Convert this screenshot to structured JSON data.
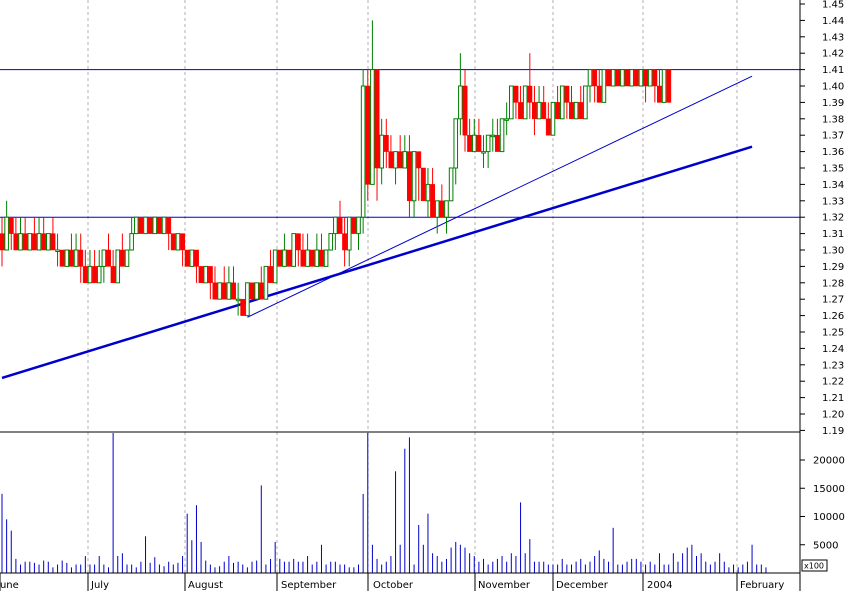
{
  "chart_data": [
    {
      "type": "candlestick",
      "title": "",
      "y_ticks": [
        "1.45",
        "1.44",
        "1.43",
        "1.42",
        "1.41",
        "1.40",
        "1.39",
        "1.38",
        "1.37",
        "1.36",
        "1.35",
        "1.34",
        "1.33",
        "1.32",
        "1.31",
        "1.30",
        "1.29",
        "1.28",
        "1.27",
        "1.26",
        "1.25",
        "1.24",
        "1.23",
        "1.22",
        "1.21",
        "1.20",
        "1.19"
      ],
      "ylim": [
        1.182,
        1.452
      ],
      "x_month_labels": [
        "June",
        "July",
        "August",
        "September",
        "October",
        "November",
        "December",
        "2004",
        "February"
      ],
      "up_color": "#008000",
      "down_color": "#ff0000",
      "horizontal_lines": [
        1.41,
        1.32
      ],
      "trendlines": [
        {
          "kind": "thick",
          "color": "#0000cc",
          "from": [
            0,
            1.222
          ],
          "to": [
            162,
            1.363
          ]
        },
        {
          "kind": "thin",
          "color": "#0000cc",
          "from": [
            53,
            1.259
          ],
          "to": [
            162,
            1.406
          ]
        }
      ],
      "ohlc_note": "daily bars, first bar ~ early June 2003, last bar ~ early February 2004",
      "candles": [
        [
          1.31,
          1.32,
          1.29,
          1.3
        ],
        [
          1.3,
          1.33,
          1.3,
          1.32
        ],
        [
          1.32,
          1.32,
          1.3,
          1.31
        ],
        [
          1.31,
          1.32,
          1.3,
          1.3
        ],
        [
          1.3,
          1.32,
          1.3,
          1.31
        ],
        [
          1.31,
          1.32,
          1.3,
          1.3
        ],
        [
          1.3,
          1.31,
          1.3,
          1.31
        ],
        [
          1.31,
          1.32,
          1.3,
          1.3
        ],
        [
          1.3,
          1.32,
          1.3,
          1.31
        ],
        [
          1.31,
          1.32,
          1.3,
          1.3
        ],
        [
          1.3,
          1.31,
          1.3,
          1.31
        ],
        [
          1.31,
          1.32,
          1.3,
          1.3
        ],
        [
          1.3,
          1.31,
          1.29,
          1.3
        ],
        [
          1.3,
          1.3,
          1.29,
          1.29
        ],
        [
          1.29,
          1.3,
          1.29,
          1.3
        ],
        [
          1.3,
          1.31,
          1.29,
          1.29
        ],
        [
          1.29,
          1.31,
          1.29,
          1.3
        ],
        [
          1.3,
          1.31,
          1.28,
          1.29
        ],
        [
          1.29,
          1.3,
          1.28,
          1.28
        ],
        [
          1.28,
          1.3,
          1.28,
          1.29
        ],
        [
          1.29,
          1.3,
          1.28,
          1.28
        ],
        [
          1.28,
          1.3,
          1.28,
          1.29
        ],
        [
          1.29,
          1.3,
          1.28,
          1.3
        ],
        [
          1.3,
          1.31,
          1.29,
          1.29
        ],
        [
          1.29,
          1.3,
          1.28,
          1.28
        ],
        [
          1.28,
          1.3,
          1.28,
          1.3
        ],
        [
          1.3,
          1.31,
          1.29,
          1.29
        ],
        [
          1.29,
          1.3,
          1.29,
          1.3
        ],
        [
          1.3,
          1.32,
          1.3,
          1.31
        ],
        [
          1.31,
          1.32,
          1.31,
          1.32
        ],
        [
          1.32,
          1.32,
          1.31,
          1.31
        ],
        [
          1.31,
          1.32,
          1.31,
          1.32
        ],
        [
          1.32,
          1.32,
          1.31,
          1.31
        ],
        [
          1.31,
          1.32,
          1.31,
          1.32
        ],
        [
          1.32,
          1.32,
          1.31,
          1.31
        ],
        [
          1.31,
          1.32,
          1.31,
          1.32
        ],
        [
          1.32,
          1.32,
          1.3,
          1.31
        ],
        [
          1.31,
          1.31,
          1.3,
          1.3
        ],
        [
          1.3,
          1.31,
          1.3,
          1.31
        ],
        [
          1.31,
          1.31,
          1.29,
          1.3
        ],
        [
          1.3,
          1.3,
          1.29,
          1.29
        ],
        [
          1.29,
          1.3,
          1.29,
          1.3
        ],
        [
          1.3,
          1.3,
          1.28,
          1.29
        ],
        [
          1.29,
          1.29,
          1.28,
          1.28
        ],
        [
          1.28,
          1.29,
          1.28,
          1.29
        ],
        [
          1.29,
          1.29,
          1.27,
          1.28
        ],
        [
          1.28,
          1.29,
          1.27,
          1.27
        ],
        [
          1.27,
          1.28,
          1.27,
          1.28
        ],
        [
          1.28,
          1.29,
          1.27,
          1.27
        ],
        [
          1.27,
          1.29,
          1.27,
          1.28
        ],
        [
          1.28,
          1.29,
          1.27,
          1.27
        ],
        [
          1.27,
          1.28,
          1.26,
          1.27
        ],
        [
          1.27,
          1.27,
          1.26,
          1.26
        ],
        [
          1.26,
          1.28,
          1.26,
          1.28
        ],
        [
          1.28,
          1.28,
          1.27,
          1.27
        ],
        [
          1.27,
          1.28,
          1.27,
          1.28
        ],
        [
          1.28,
          1.29,
          1.27,
          1.27
        ],
        [
          1.27,
          1.29,
          1.27,
          1.29
        ],
        [
          1.29,
          1.3,
          1.28,
          1.28
        ],
        [
          1.28,
          1.3,
          1.28,
          1.3
        ],
        [
          1.3,
          1.3,
          1.29,
          1.29
        ],
        [
          1.29,
          1.31,
          1.29,
          1.3
        ],
        [
          1.3,
          1.3,
          1.29,
          1.29
        ],
        [
          1.29,
          1.31,
          1.29,
          1.31
        ],
        [
          1.31,
          1.31,
          1.29,
          1.3
        ],
        [
          1.3,
          1.31,
          1.29,
          1.29
        ],
        [
          1.29,
          1.31,
          1.29,
          1.3
        ],
        [
          1.3,
          1.3,
          1.29,
          1.29
        ],
        [
          1.29,
          1.31,
          1.29,
          1.3
        ],
        [
          1.3,
          1.31,
          1.29,
          1.29
        ],
        [
          1.29,
          1.3,
          1.29,
          1.3
        ],
        [
          1.3,
          1.31,
          1.3,
          1.31
        ],
        [
          1.31,
          1.32,
          1.3,
          1.32
        ],
        [
          1.32,
          1.33,
          1.31,
          1.31
        ],
        [
          1.31,
          1.32,
          1.29,
          1.3
        ],
        [
          1.3,
          1.32,
          1.29,
          1.32
        ],
        [
          1.32,
          1.32,
          1.31,
          1.31
        ],
        [
          1.31,
          1.32,
          1.3,
          1.32
        ],
        [
          1.32,
          1.41,
          1.31,
          1.4
        ],
        [
          1.4,
          1.41,
          1.33,
          1.34
        ],
        [
          1.34,
          1.44,
          1.34,
          1.41
        ],
        [
          1.41,
          1.41,
          1.33,
          1.35
        ],
        [
          1.35,
          1.38,
          1.34,
          1.37
        ],
        [
          1.37,
          1.38,
          1.35,
          1.36
        ],
        [
          1.36,
          1.37,
          1.35,
          1.35
        ],
        [
          1.35,
          1.36,
          1.34,
          1.36
        ],
        [
          1.36,
          1.37,
          1.35,
          1.35
        ],
        [
          1.35,
          1.37,
          1.35,
          1.36
        ],
        [
          1.36,
          1.37,
          1.32,
          1.33
        ],
        [
          1.33,
          1.36,
          1.32,
          1.36
        ],
        [
          1.36,
          1.36,
          1.33,
          1.35
        ],
        [
          1.35,
          1.35,
          1.33,
          1.33
        ],
        [
          1.33,
          1.35,
          1.32,
          1.34
        ],
        [
          1.34,
          1.35,
          1.32,
          1.32
        ],
        [
          1.32,
          1.33,
          1.31,
          1.33
        ],
        [
          1.33,
          1.34,
          1.32,
          1.32
        ],
        [
          1.32,
          1.33,
          1.31,
          1.33
        ],
        [
          1.33,
          1.35,
          1.33,
          1.35
        ],
        [
          1.35,
          1.38,
          1.34,
          1.38
        ],
        [
          1.38,
          1.42,
          1.37,
          1.4
        ],
        [
          1.4,
          1.41,
          1.36,
          1.37
        ],
        [
          1.37,
          1.38,
          1.36,
          1.36
        ],
        [
          1.36,
          1.38,
          1.36,
          1.37
        ],
        [
          1.37,
          1.38,
          1.36,
          1.36
        ],
        [
          1.36,
          1.37,
          1.35,
          1.36
        ],
        [
          1.36,
          1.37,
          1.35,
          1.37
        ],
        [
          1.37,
          1.38,
          1.36,
          1.37
        ],
        [
          1.37,
          1.38,
          1.36,
          1.36
        ],
        [
          1.36,
          1.38,
          1.36,
          1.38
        ],
        [
          1.38,
          1.39,
          1.37,
          1.38
        ],
        [
          1.38,
          1.4,
          1.38,
          1.4
        ],
        [
          1.4,
          1.4,
          1.38,
          1.39
        ],
        [
          1.39,
          1.4,
          1.38,
          1.38
        ],
        [
          1.38,
          1.4,
          1.38,
          1.4
        ],
        [
          1.4,
          1.42,
          1.38,
          1.39
        ],
        [
          1.39,
          1.4,
          1.37,
          1.38
        ],
        [
          1.38,
          1.4,
          1.38,
          1.39
        ],
        [
          1.39,
          1.4,
          1.38,
          1.38
        ],
        [
          1.38,
          1.39,
          1.37,
          1.37
        ],
        [
          1.37,
          1.39,
          1.37,
          1.39
        ],
        [
          1.39,
          1.4,
          1.38,
          1.38
        ],
        [
          1.38,
          1.4,
          1.38,
          1.4
        ],
        [
          1.4,
          1.4,
          1.38,
          1.39
        ],
        [
          1.39,
          1.4,
          1.38,
          1.38
        ],
        [
          1.38,
          1.39,
          1.38,
          1.39
        ],
        [
          1.39,
          1.4,
          1.38,
          1.38
        ],
        [
          1.38,
          1.4,
          1.38,
          1.4
        ],
        [
          1.4,
          1.41,
          1.39,
          1.41
        ],
        [
          1.41,
          1.41,
          1.39,
          1.4
        ],
        [
          1.4,
          1.41,
          1.39,
          1.39
        ],
        [
          1.39,
          1.41,
          1.39,
          1.41
        ],
        [
          1.41,
          1.41,
          1.4,
          1.4
        ],
        [
          1.4,
          1.41,
          1.4,
          1.41
        ],
        [
          1.41,
          1.41,
          1.4,
          1.4
        ],
        [
          1.4,
          1.41,
          1.4,
          1.41
        ],
        [
          1.41,
          1.41,
          1.4,
          1.4
        ],
        [
          1.4,
          1.41,
          1.4,
          1.41
        ],
        [
          1.41,
          1.41,
          1.4,
          1.4
        ],
        [
          1.4,
          1.41,
          1.4,
          1.41
        ],
        [
          1.41,
          1.41,
          1.39,
          1.4
        ],
        [
          1.4,
          1.41,
          1.4,
          1.41
        ],
        [
          1.41,
          1.41,
          1.39,
          1.4
        ],
        [
          1.4,
          1.41,
          1.39,
          1.39
        ],
        [
          1.39,
          1.41,
          1.39,
          1.41
        ],
        [
          1.41,
          1.41,
          1.39,
          1.39
        ]
      ]
    },
    {
      "type": "bar",
      "title": "",
      "y_ticks": [
        "20000",
        "15000",
        "10000",
        "5000"
      ],
      "ylim": [
        0,
        25000
      ],
      "unit_label": "x100",
      "bar_color": "#0000cc",
      "values": [
        14000,
        9500,
        7500,
        2500,
        1500,
        2000,
        2000,
        1800,
        1500,
        2200,
        2000,
        1000,
        1500,
        2200,
        1800,
        1000,
        1500,
        1500,
        3000,
        1500,
        1500,
        3000,
        1500,
        1000,
        25000,
        3000,
        3500,
        1500,
        1500,
        1000,
        2000,
        6500,
        1800,
        2800,
        1500,
        1200,
        2000,
        1500,
        1800,
        3000,
        10500,
        5800,
        12000,
        5500,
        2200,
        1500,
        1000,
        1200,
        2000,
        3000,
        1800,
        2000,
        1500,
        1000,
        2000,
        2200,
        15500,
        1500,
        2500,
        5500,
        2500,
        2000,
        2000,
        2500,
        2000,
        2000,
        3000,
        1500,
        2000,
        5000,
        1500,
        2000,
        2000,
        1500,
        1500,
        1000,
        1000,
        1500,
        14000,
        25000,
        5000,
        2500,
        1500,
        2000,
        3000,
        18000,
        5000,
        22000,
        24000,
        1500,
        8500,
        5000,
        10500,
        3500,
        3000,
        2000,
        2500,
        4500,
        5500,
        5000,
        4500,
        3500,
        3000,
        2000,
        2500,
        1500,
        2000,
        2500,
        3000,
        2000,
        3500,
        3000,
        12500,
        3500,
        6000,
        2000,
        2000,
        2000,
        1500,
        1500,
        1500,
        2500,
        1500,
        1500,
        2000,
        2500,
        1500,
        2000,
        3000,
        4000,
        2500,
        2000,
        8000,
        1500,
        1500,
        2000,
        2500,
        2500,
        2000,
        1500,
        2000,
        1500,
        3500,
        1500,
        1500,
        3500,
        2000,
        3500,
        4500,
        5000,
        3000,
        3500,
        2000,
        1500,
        2000,
        3500,
        2000,
        1000,
        1500,
        1000,
        1500,
        2000,
        5000,
        1500,
        1500,
        1000
      ]
    }
  ]
}
